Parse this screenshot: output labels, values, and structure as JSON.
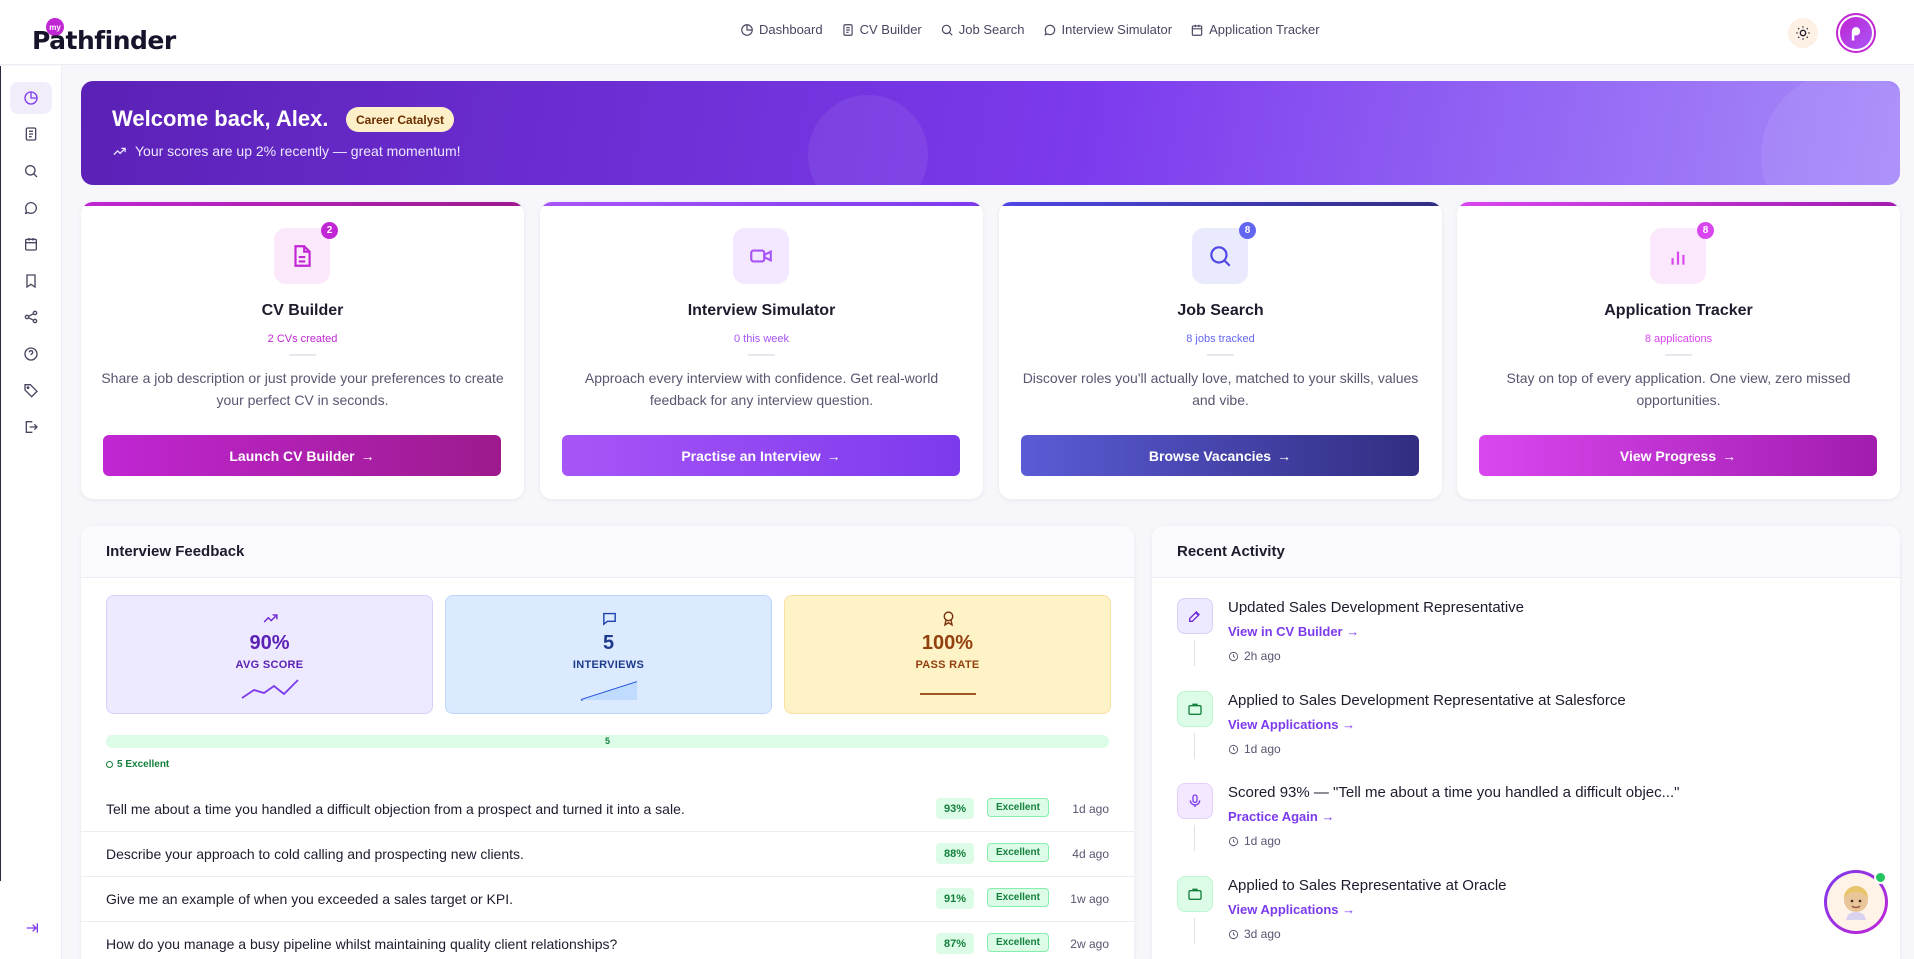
{
  "app": {
    "logo_small": "my",
    "logo_word": "Pathfinder"
  },
  "nav": [
    {
      "label": "Dashboard",
      "icon": "dashboard-icon"
    },
    {
      "label": "CV Builder",
      "icon": "document-icon"
    },
    {
      "label": "Job Search",
      "icon": "search-icon"
    },
    {
      "label": "Interview Simulator",
      "icon": "chat-icon"
    },
    {
      "label": "Application Tracker",
      "icon": "calendar-icon"
    }
  ],
  "sidebar": [
    "dashboard-icon",
    "document-icon",
    "search-icon",
    "chat-icon",
    "calendar-icon",
    "bookmark-icon",
    "share-icon",
    "help-icon",
    "tag-icon",
    "logout-icon"
  ],
  "banner": {
    "title": "Welcome back, Alex.",
    "badge": "Career Catalyst",
    "subtitle": "Your scores are up 2% recently — great momentum!"
  },
  "cards": [
    {
      "title": "CV Builder",
      "count": "2",
      "stat": "2 CVs created",
      "desc": "Share a job description or just provide your preferences to create your perfect CV in seconds.",
      "button": "Launch CV Builder",
      "accent": "#c026d3"
    },
    {
      "title": "Interview Simulator",
      "count": "",
      "stat": "0 this week",
      "desc": "Approach every interview with confidence. Get real-world feedback for any interview question.",
      "button": "Practise an Interview",
      "accent": "#a855f7"
    },
    {
      "title": "Job Search",
      "count": "8",
      "stat": "8 jobs tracked",
      "desc": "Discover roles you'll actually love, matched to your skills, values and vibe.",
      "button": "Browse Vacancies",
      "accent": "#4f46e5"
    },
    {
      "title": "Application Tracker",
      "count": "8",
      "stat": "8 applications",
      "desc": "Stay on top of every application. One view, zero missed opportunities.",
      "button": "View Progress",
      "accent": "#d946ef"
    }
  ],
  "feedback": {
    "title": "Interview Feedback",
    "metrics": [
      {
        "value": "90%",
        "label": "AVG SCORE"
      },
      {
        "value": "5",
        "label": "INTERVIEWS"
      },
      {
        "value": "100%",
        "label": "PASS RATE"
      }
    ],
    "bar_count": "5",
    "bar_fraction": 1.0,
    "legend": "5 Excellent",
    "questions": [
      {
        "text": "Tell me about a time you handled a difficult objection from a prospect and turned it into a sale.",
        "score": "93%",
        "rating": "Excellent",
        "time": "1d ago"
      },
      {
        "text": "Describe your approach to cold calling and prospecting new clients.",
        "score": "88%",
        "rating": "Excellent",
        "time": "4d ago"
      },
      {
        "text": "Give me an example of when you exceeded a sales target or KPI.",
        "score": "91%",
        "rating": "Excellent",
        "time": "1w ago"
      },
      {
        "text": "How do you manage a busy pipeline whilst maintaining quality client relationships?",
        "score": "87%",
        "rating": "Excellent",
        "time": "2w ago"
      }
    ]
  },
  "activity": {
    "title": "Recent Activity",
    "items": [
      {
        "title": "Updated Sales Development Representative",
        "link": "View in CV Builder →",
        "time": "2h ago",
        "icon": "edit-icon"
      },
      {
        "title": "Applied to Sales Development Representative at Salesforce",
        "link": "View Applications →",
        "time": "1d ago",
        "icon": "briefcase-icon"
      },
      {
        "title": "Scored 93% — \"Tell me about a time you handled a difficult objec...\"",
        "link": "Practice Again →",
        "time": "1d ago",
        "icon": "microphone-icon"
      },
      {
        "title": "Applied to Sales Representative at Oracle",
        "link": "View Applications →",
        "time": "3d ago",
        "icon": "briefcase-icon"
      }
    ]
  }
}
